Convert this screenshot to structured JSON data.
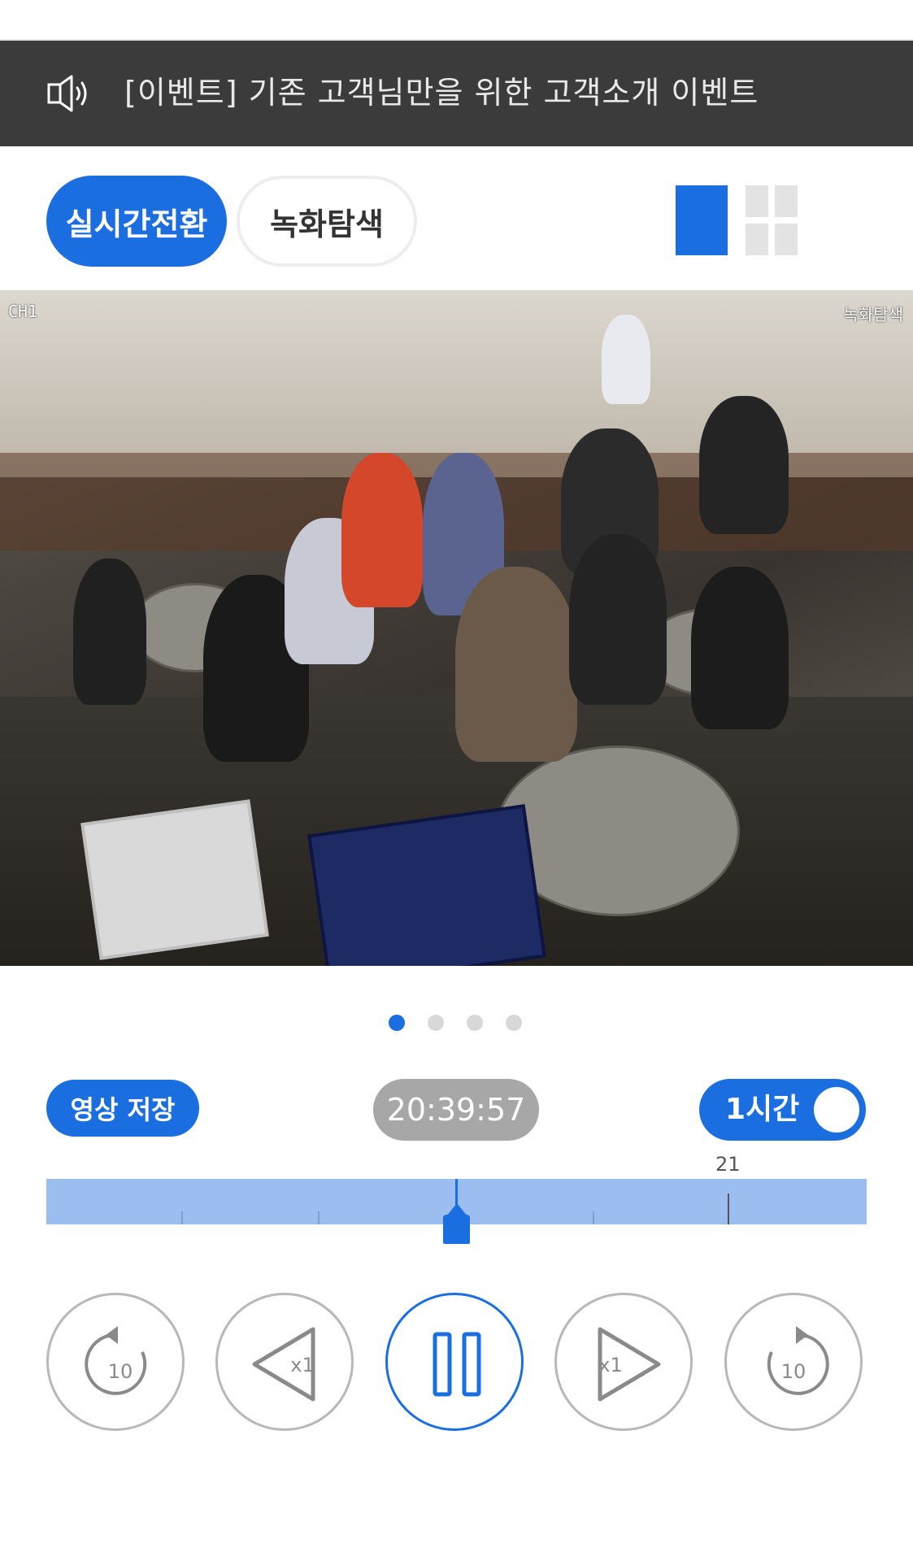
{
  "notice": {
    "text": "[이벤트] 기존 고객님만을 위한 고객소개 이벤트",
    "icon": "speaker-icon"
  },
  "tabs": [
    {
      "label": "실시간전환",
      "active": true
    },
    {
      "label": "녹화탐색",
      "active": false
    }
  ],
  "layout": {
    "single_icon": "single-view-icon",
    "quad_icon": "quad-view-icon",
    "selected": "single"
  },
  "video": {
    "channel": "CH1",
    "mode": "녹화탐색"
  },
  "pager": {
    "count": 4,
    "active_index": 0
  },
  "controls": {
    "save_label": "영상 저장",
    "time": "20:39:57",
    "range_label": "1시간",
    "range_enabled": true
  },
  "timeline": {
    "hour_label": "21"
  },
  "playback": {
    "rewind_seconds": "10",
    "back_speed": "x1",
    "forward_speed": "x1",
    "forward_seconds": "10",
    "state": "playing"
  },
  "colors": {
    "accent": "#1a6ee0",
    "notice_bg": "#3b3b3b",
    "timeline_fill": "#9bbdf0",
    "time_pill": "#a7a7a7"
  }
}
